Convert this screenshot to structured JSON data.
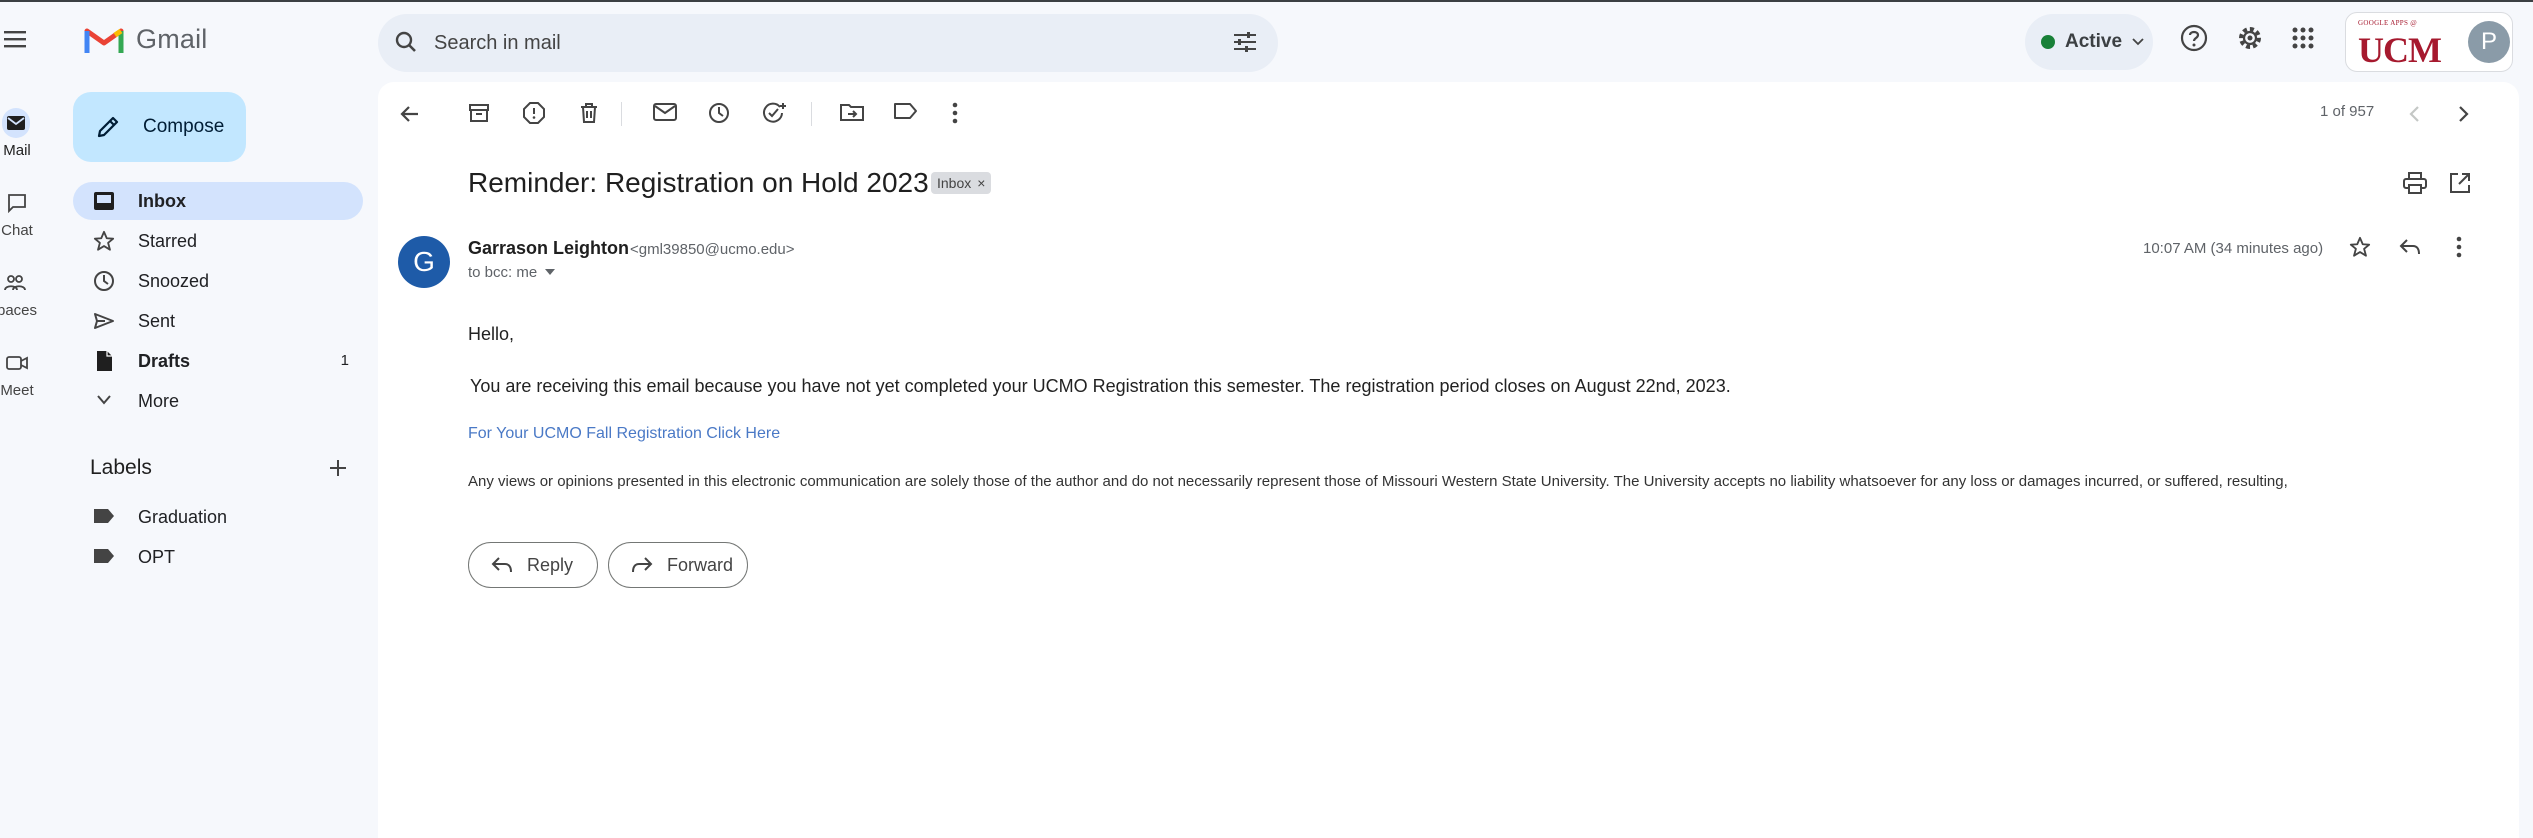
{
  "app": {
    "name": "Gmail"
  },
  "rail": {
    "items": [
      {
        "label": "Mail"
      },
      {
        "label": "Chat"
      },
      {
        "label": "paces"
      },
      {
        "label": "Meet"
      }
    ]
  },
  "search": {
    "placeholder": "Search in mail"
  },
  "status": {
    "label": "Active",
    "color": "#188038"
  },
  "org": {
    "logo_text": "UCM",
    "logo_small": "GOOGLE APPS @",
    "avatar_letter": "P"
  },
  "sidebar": {
    "compose_label": "Compose",
    "items": [
      {
        "label": "Inbox",
        "count": "",
        "icon": "inbox-icon"
      },
      {
        "label": "Starred",
        "count": "",
        "icon": "star-icon"
      },
      {
        "label": "Snoozed",
        "count": "",
        "icon": "clock-icon"
      },
      {
        "label": "Sent",
        "count": "",
        "icon": "send-icon"
      },
      {
        "label": "Drafts",
        "count": "1",
        "icon": "draft-icon"
      },
      {
        "label": "More",
        "count": "",
        "icon": "chevron-down-icon"
      }
    ],
    "labels_heading": "Labels",
    "labels": [
      {
        "label": "Graduation"
      },
      {
        "label": "OPT"
      }
    ]
  },
  "message": {
    "pager": "1 of 957",
    "subject": "Reminder: Registration on Hold 2023",
    "chip": "Inbox",
    "chip_close": "×",
    "sender_initial": "G",
    "sender_name": "Garrason Leighton",
    "sender_email": "<gml39850@ucmo.edu>",
    "to": "to bcc: me",
    "time": "10:07 AM (34 minutes ago)",
    "greeting": "Hello,",
    "body": "You are receiving this email because you have not yet completed your UCMO Registration this semester. The registration period closes on August 22nd, 2023.",
    "link": "For Your UCMO Fall Registration Click Here",
    "disclaimer": "Any views or opinions presented in this electronic communication are solely those of the author and do not necessarily represent those of Missouri Western State University.  The University accepts no liability whatsoever for any loss or damages incurred, or suffered, resulting,",
    "reply_label": "Reply",
    "forward_label": "Forward"
  }
}
